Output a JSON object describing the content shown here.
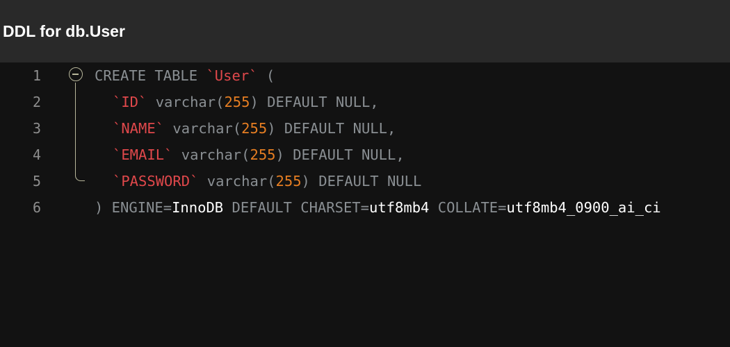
{
  "header": {
    "title": "DDL for db.User"
  },
  "editor": {
    "line_numbers": [
      "1",
      "2",
      "3",
      "4",
      "5",
      "6"
    ],
    "lines": [
      [
        {
          "text": "CREATE TABLE ",
          "cls": "tok-kw"
        },
        {
          "text": "`User`",
          "cls": "tok-ident"
        },
        {
          "text": " (",
          "cls": "tok-punct"
        }
      ],
      [
        {
          "text": "`ID`",
          "cls": "tok-ident"
        },
        {
          "text": " varchar(",
          "cls": "tok-kw"
        },
        {
          "text": "255",
          "cls": "tok-num"
        },
        {
          "text": ") DEFAULT NULL,",
          "cls": "tok-kw"
        }
      ],
      [
        {
          "text": "`NAME`",
          "cls": "tok-ident"
        },
        {
          "text": " varchar(",
          "cls": "tok-kw"
        },
        {
          "text": "255",
          "cls": "tok-num"
        },
        {
          "text": ") DEFAULT NULL,",
          "cls": "tok-kw"
        }
      ],
      [
        {
          "text": "`EMAIL`",
          "cls": "tok-ident"
        },
        {
          "text": " varchar(",
          "cls": "tok-kw"
        },
        {
          "text": "255",
          "cls": "tok-num"
        },
        {
          "text": ") DEFAULT NULL,",
          "cls": "tok-kw"
        }
      ],
      [
        {
          "text": "`PASSWORD`",
          "cls": "tok-ident"
        },
        {
          "text": " varchar(",
          "cls": "tok-kw"
        },
        {
          "text": "255",
          "cls": "tok-num"
        },
        {
          "text": ") DEFAULT NULL",
          "cls": "tok-kw"
        }
      ],
      [
        {
          "text": ") ENGINE=",
          "cls": "tok-kw"
        },
        {
          "text": "InnoDB",
          "cls": "tok-plain"
        },
        {
          "text": " DEFAULT CHARSET=",
          "cls": "tok-kw"
        },
        {
          "text": "utf8mb4",
          "cls": "tok-plain"
        },
        {
          "text": " COLLATE=",
          "cls": "tok-kw"
        },
        {
          "text": "utf8mb4_0900_ai_ci",
          "cls": "tok-plain"
        }
      ]
    ],
    "fold_icon": "collapse-minus-icon"
  },
  "colors": {
    "header_bg": "#292929",
    "editor_bg": "#121212",
    "keyword": "#8a8f93",
    "identifier": "#e0484b",
    "number": "#e67e22",
    "plain": "#ffffff",
    "line_number": "#8e8e8e"
  }
}
